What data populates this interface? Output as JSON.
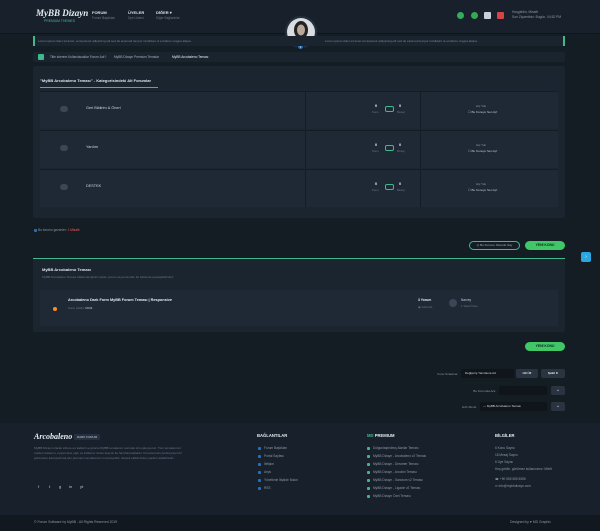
{
  "header": {
    "logo": "MyBB Dizayn",
    "logo_sub": "PREMIUM THEMES",
    "nav": [
      {
        "label": "FORUM",
        "sub": "Forum Başlıkları"
      },
      {
        "label": "ÜYELER",
        "sub": "Üye Listesi"
      },
      {
        "label": "DİĞER",
        "sub": "Diğer Bağlantılar"
      }
    ],
    "welcome_line1": "Hoşgeldin, Misafir",
    "welcome_line2": "Son Ziyaretiniz: Bugün, 04:52 PM"
  },
  "notice": {
    "left": "Lorem ipsum dolor sit amet, consectetur adipiscing elit sed do eiusmod tempor incididunt ut et labore magna aliqua.",
    "right": "Lorem ipsum dolor sit amet consectetur adipiscing elit sed do eiusmod tempor incididunt ut et labore magna aliqua."
  },
  "breadcrumb": [
    "Title skerem Kullanılacaklar Forum Adı?",
    "MyBB Dizayn Premium Temalar",
    "MyBB Arcobaleno Teması"
  ],
  "forums": {
    "title": "\"MyBB Arcobaleno Teması\" - Kategorisindeki Alt Forumlar",
    "rows": [
      {
        "name": "Geri Bildirim & Öneri",
        "threads": "0",
        "posts": "0",
        "threads_label": "Konu",
        "posts_label": "Mesaj",
        "last_label": "Hiç Yok",
        "last_value": "Bu Konuyu Sen Aç!"
      },
      {
        "name": "Yardım",
        "threads": "0",
        "posts": "0",
        "threads_label": "Konu",
        "posts_label": "Mesaj",
        "last_label": "Hiç Yok",
        "last_value": "Bu Konuyu Sen Aç!"
      },
      {
        "name": "DESTEK",
        "threads": "0",
        "posts": "0",
        "threads_label": "Konu",
        "posts_label": "Mesaj",
        "last_label": "Hiç Yok",
        "last_value": "Bu Konuyu Sen Aç!"
      }
    ]
  },
  "browsing": {
    "prefix": "Bu forumu gezenler:",
    "who": "1 Misafir"
  },
  "actions": {
    "mark_read": "Bu Forumu Okundu Say",
    "new_thread": "YENİ KONU"
  },
  "threads": {
    "title": "MyBB Arcobaleno Teması",
    "desc": "MyBB Arcobaleno Teması hakkında ilginizi çeken yorum veya konuları bu bölümde paylaşabilirsiniz.",
    "items": [
      {
        "title": "Arcobaleno Dark Form MyBB Forum Teması | Responsive",
        "meta_label": "Konu sahibi:",
        "author": "Mizfit",
        "replies": "3 Yorum",
        "views": "Görüntü",
        "last_user": "Narvey",
        "last_time": "1 Saat Önce"
      }
    ]
  },
  "widgets": {
    "sort_label": "Konu Sıralama:",
    "sort_value": "Değişmiş Yanıtlama Ad",
    "sort_btn1": "Hit Ü2",
    "sort_btn2": "Şekil K",
    "search_label": "Bu Forumda Ara:",
    "search_placeholder": "",
    "search_btn": "»",
    "jump_label": "Hızlı Menü:",
    "jump_value": "— MyBB Arcobaleno Teması",
    "jump_btn": "»"
  },
  "footer": {
    "logo": "Arcobaleno",
    "logo_tag": "DARK FORUM",
    "about": "MyBB Dizayn olarak sizlere en kaliteli ve güncel MyBB temalarını sunmak için çalışıyoruz. Tüm temalarımız modern tasarım, responsive yapı ve kullanıcı dostu arayüz ile hazırlanmaktadır. Forumunuzu profesyonel bir görünüme kavuşturmak için premium temalarımızı inceleyebilir, destek ekibimizden yardım alabilirsiniz.",
    "social": [
      "f",
      "t",
      "g",
      "in",
      "yt"
    ],
    "links_title": "BAĞLANTILAR",
    "links": [
      "Forum Başlıkları",
      "Portal Sayfası",
      "İletişim",
      "Arşiv",
      "Yönetimle İlişkide Bulun",
      "RSS"
    ],
    "premium_prefix": "MD",
    "premium_title": "PREMIUM",
    "premium": [
      "Dolgunlaştırılmış Alanlar Teması",
      "MyBB Dizayn - Arcobaleno v2 Teması",
      "MyBB Dizayn - Dreamer Teması",
      "MyBB Dizayn - Arcobin Teması",
      "MyBB Dizayn - Sanctum v2 Teması",
      "MyBB Dizayn - Ligacie v2 Teması",
      "MyBB Dizayn Özel Teması"
    ],
    "info_title": "BİLGİLER",
    "info": [
      "6 Konu Sayısı",
      "18 Mesaj Sayısı",
      "6 Üye Sayısı",
      "Hoş geldin, görülmez kullanıcımız: Mizfit"
    ],
    "phone": "+90 555 555 5555",
    "email": "info@mybbdizayn.com"
  },
  "bottom": {
    "copy": "© Forum Software by MyBB - All Rights Reserved 2019",
    "design": "Designed by ♥ MD Graphic"
  }
}
